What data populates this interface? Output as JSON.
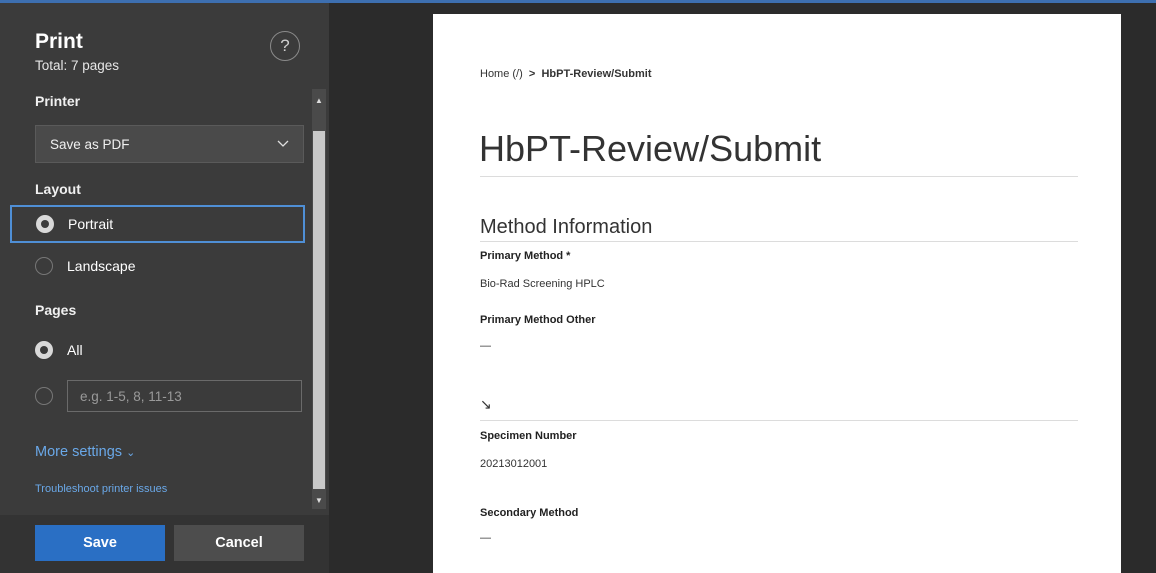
{
  "panel": {
    "title": "Print",
    "subtitle": "Total: 7 pages",
    "help_glyph": "?",
    "printer_label": "Printer",
    "printer_value": "Save as PDF",
    "layout_label": "Layout",
    "layout_options": [
      "Portrait",
      "Landscape"
    ],
    "layout_selected": "Portrait",
    "pages_label": "Pages",
    "pages_all": "All",
    "pages_range_placeholder": "e.g. 1-5, 8, 11-13",
    "more_settings": "More settings",
    "troubleshoot": "Troubleshoot printer issues",
    "save_label": "Save",
    "cancel_label": "Cancel"
  },
  "preview": {
    "breadcrumb_home": "Home (/)",
    "breadcrumb_sep": ">",
    "breadcrumb_current": "HbPT-Review/Submit",
    "page_title": "HbPT-Review/Submit",
    "section_title": "Method Information",
    "fields": [
      {
        "label": "Primary Method *",
        "value": "Bio-Rad Screening HPLC"
      },
      {
        "label": "Primary Method Other",
        "value": "—"
      },
      {
        "label": "Specimen Number",
        "value": "20213012001"
      },
      {
        "label": "Secondary Method",
        "value": "—"
      }
    ],
    "arrow_glyph": "↘"
  },
  "colors": {
    "panel_bg": "#3b3b3b",
    "accent": "#2a6fc4",
    "link": "#6aa8e8",
    "focus": "#4f8fd6"
  }
}
